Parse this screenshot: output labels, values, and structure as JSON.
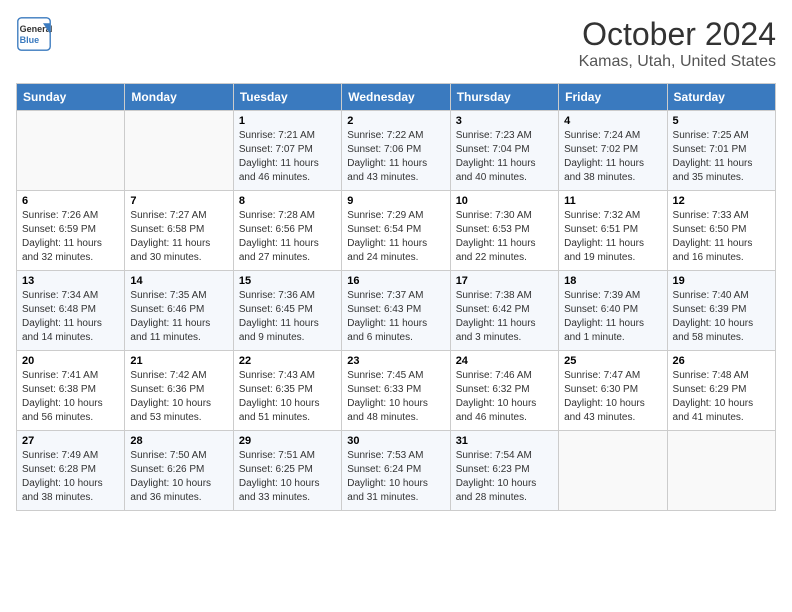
{
  "header": {
    "logo_line1": "General",
    "logo_line2": "Blue",
    "title": "October 2024",
    "subtitle": "Kamas, Utah, United States"
  },
  "days_of_week": [
    "Sunday",
    "Monday",
    "Tuesday",
    "Wednesday",
    "Thursday",
    "Friday",
    "Saturday"
  ],
  "weeks": [
    [
      {
        "day": "",
        "sunrise": "",
        "sunset": "",
        "daylight": ""
      },
      {
        "day": "",
        "sunrise": "",
        "sunset": "",
        "daylight": ""
      },
      {
        "day": "1",
        "sunrise": "Sunrise: 7:21 AM",
        "sunset": "Sunset: 7:07 PM",
        "daylight": "Daylight: 11 hours and 46 minutes."
      },
      {
        "day": "2",
        "sunrise": "Sunrise: 7:22 AM",
        "sunset": "Sunset: 7:06 PM",
        "daylight": "Daylight: 11 hours and 43 minutes."
      },
      {
        "day": "3",
        "sunrise": "Sunrise: 7:23 AM",
        "sunset": "Sunset: 7:04 PM",
        "daylight": "Daylight: 11 hours and 40 minutes."
      },
      {
        "day": "4",
        "sunrise": "Sunrise: 7:24 AM",
        "sunset": "Sunset: 7:02 PM",
        "daylight": "Daylight: 11 hours and 38 minutes."
      },
      {
        "day": "5",
        "sunrise": "Sunrise: 7:25 AM",
        "sunset": "Sunset: 7:01 PM",
        "daylight": "Daylight: 11 hours and 35 minutes."
      }
    ],
    [
      {
        "day": "6",
        "sunrise": "Sunrise: 7:26 AM",
        "sunset": "Sunset: 6:59 PM",
        "daylight": "Daylight: 11 hours and 32 minutes."
      },
      {
        "day": "7",
        "sunrise": "Sunrise: 7:27 AM",
        "sunset": "Sunset: 6:58 PM",
        "daylight": "Daylight: 11 hours and 30 minutes."
      },
      {
        "day": "8",
        "sunrise": "Sunrise: 7:28 AM",
        "sunset": "Sunset: 6:56 PM",
        "daylight": "Daylight: 11 hours and 27 minutes."
      },
      {
        "day": "9",
        "sunrise": "Sunrise: 7:29 AM",
        "sunset": "Sunset: 6:54 PM",
        "daylight": "Daylight: 11 hours and 24 minutes."
      },
      {
        "day": "10",
        "sunrise": "Sunrise: 7:30 AM",
        "sunset": "Sunset: 6:53 PM",
        "daylight": "Daylight: 11 hours and 22 minutes."
      },
      {
        "day": "11",
        "sunrise": "Sunrise: 7:32 AM",
        "sunset": "Sunset: 6:51 PM",
        "daylight": "Daylight: 11 hours and 19 minutes."
      },
      {
        "day": "12",
        "sunrise": "Sunrise: 7:33 AM",
        "sunset": "Sunset: 6:50 PM",
        "daylight": "Daylight: 11 hours and 16 minutes."
      }
    ],
    [
      {
        "day": "13",
        "sunrise": "Sunrise: 7:34 AM",
        "sunset": "Sunset: 6:48 PM",
        "daylight": "Daylight: 11 hours and 14 minutes."
      },
      {
        "day": "14",
        "sunrise": "Sunrise: 7:35 AM",
        "sunset": "Sunset: 6:46 PM",
        "daylight": "Daylight: 11 hours and 11 minutes."
      },
      {
        "day": "15",
        "sunrise": "Sunrise: 7:36 AM",
        "sunset": "Sunset: 6:45 PM",
        "daylight": "Daylight: 11 hours and 9 minutes."
      },
      {
        "day": "16",
        "sunrise": "Sunrise: 7:37 AM",
        "sunset": "Sunset: 6:43 PM",
        "daylight": "Daylight: 11 hours and 6 minutes."
      },
      {
        "day": "17",
        "sunrise": "Sunrise: 7:38 AM",
        "sunset": "Sunset: 6:42 PM",
        "daylight": "Daylight: 11 hours and 3 minutes."
      },
      {
        "day": "18",
        "sunrise": "Sunrise: 7:39 AM",
        "sunset": "Sunset: 6:40 PM",
        "daylight": "Daylight: 11 hours and 1 minute."
      },
      {
        "day": "19",
        "sunrise": "Sunrise: 7:40 AM",
        "sunset": "Sunset: 6:39 PM",
        "daylight": "Daylight: 10 hours and 58 minutes."
      }
    ],
    [
      {
        "day": "20",
        "sunrise": "Sunrise: 7:41 AM",
        "sunset": "Sunset: 6:38 PM",
        "daylight": "Daylight: 10 hours and 56 minutes."
      },
      {
        "day": "21",
        "sunrise": "Sunrise: 7:42 AM",
        "sunset": "Sunset: 6:36 PM",
        "daylight": "Daylight: 10 hours and 53 minutes."
      },
      {
        "day": "22",
        "sunrise": "Sunrise: 7:43 AM",
        "sunset": "Sunset: 6:35 PM",
        "daylight": "Daylight: 10 hours and 51 minutes."
      },
      {
        "day": "23",
        "sunrise": "Sunrise: 7:45 AM",
        "sunset": "Sunset: 6:33 PM",
        "daylight": "Daylight: 10 hours and 48 minutes."
      },
      {
        "day": "24",
        "sunrise": "Sunrise: 7:46 AM",
        "sunset": "Sunset: 6:32 PM",
        "daylight": "Daylight: 10 hours and 46 minutes."
      },
      {
        "day": "25",
        "sunrise": "Sunrise: 7:47 AM",
        "sunset": "Sunset: 6:30 PM",
        "daylight": "Daylight: 10 hours and 43 minutes."
      },
      {
        "day": "26",
        "sunrise": "Sunrise: 7:48 AM",
        "sunset": "Sunset: 6:29 PM",
        "daylight": "Daylight: 10 hours and 41 minutes."
      }
    ],
    [
      {
        "day": "27",
        "sunrise": "Sunrise: 7:49 AM",
        "sunset": "Sunset: 6:28 PM",
        "daylight": "Daylight: 10 hours and 38 minutes."
      },
      {
        "day": "28",
        "sunrise": "Sunrise: 7:50 AM",
        "sunset": "Sunset: 6:26 PM",
        "daylight": "Daylight: 10 hours and 36 minutes."
      },
      {
        "day": "29",
        "sunrise": "Sunrise: 7:51 AM",
        "sunset": "Sunset: 6:25 PM",
        "daylight": "Daylight: 10 hours and 33 minutes."
      },
      {
        "day": "30",
        "sunrise": "Sunrise: 7:53 AM",
        "sunset": "Sunset: 6:24 PM",
        "daylight": "Daylight: 10 hours and 31 minutes."
      },
      {
        "day": "31",
        "sunrise": "Sunrise: 7:54 AM",
        "sunset": "Sunset: 6:23 PM",
        "daylight": "Daylight: 10 hours and 28 minutes."
      },
      {
        "day": "",
        "sunrise": "",
        "sunset": "",
        "daylight": ""
      },
      {
        "day": "",
        "sunrise": "",
        "sunset": "",
        "daylight": ""
      }
    ]
  ]
}
